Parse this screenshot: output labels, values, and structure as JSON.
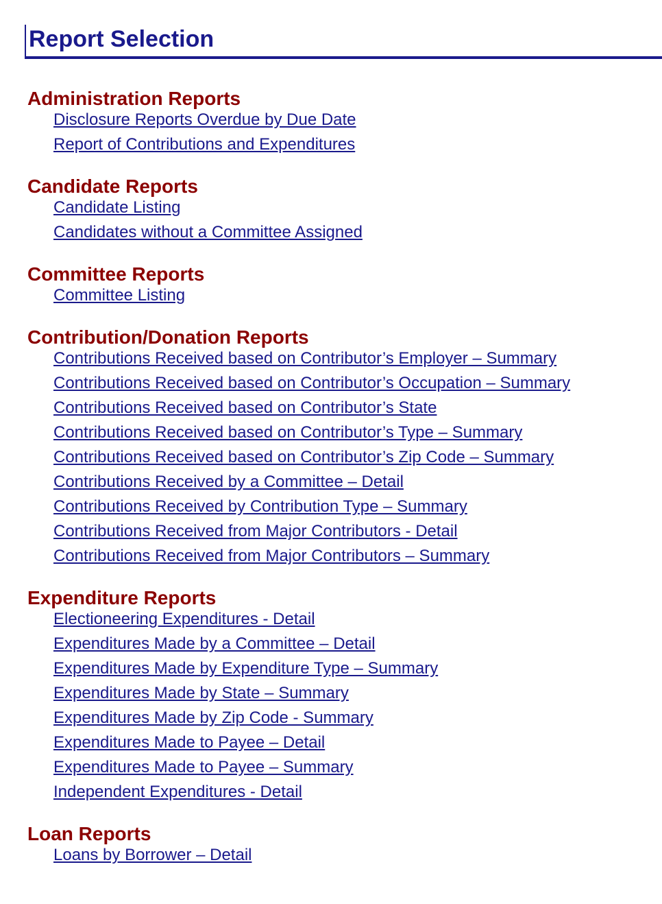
{
  "page": {
    "title": "Report Selection",
    "colors": {
      "title": "#1a1a8c",
      "section_heading": "#8b0000",
      "link": "#1a1a8c"
    }
  },
  "sections": [
    {
      "title": "Administration Reports",
      "links": [
        "Disclosure Reports Overdue by Due Date",
        "Report of Contributions and Expenditures"
      ]
    },
    {
      "title": "Candidate Reports",
      "links": [
        "Candidate Listing",
        "Candidates without a Committee Assigned"
      ]
    },
    {
      "title": "Committee Reports",
      "links": [
        "Committee Listing"
      ]
    },
    {
      "title": "Contribution/Donation Reports",
      "links": [
        "Contributions Received based on Contributor’s Employer – Summary",
        "Contributions Received based on Contributor’s Occupation – Summary",
        "Contributions Received based on Contributor’s State",
        "Contributions Received based on Contributor’s Type – Summary",
        "Contributions Received based on Contributor’s Zip Code – Summary",
        "Contributions Received by a Committee – Detail",
        "Contributions Received by Contribution Type – Summary",
        "Contributions Received from Major Contributors - Detail",
        "Contributions Received from Major Contributors – Summary"
      ]
    },
    {
      "title": "Expenditure Reports",
      "links": [
        "Electioneering Expenditures - Detail",
        "Expenditures Made by a Committee – Detail",
        "Expenditures Made by Expenditure Type – Summary",
        "Expenditures Made by State – Summary",
        "Expenditures Made by Zip Code - Summary",
        "Expenditures Made to Payee – Detail",
        "Expenditures Made to Payee – Summary",
        "Independent Expenditures - Detail"
      ]
    },
    {
      "title": "Loan Reports",
      "links": [
        "Loans by Borrower – Detail"
      ]
    }
  ]
}
